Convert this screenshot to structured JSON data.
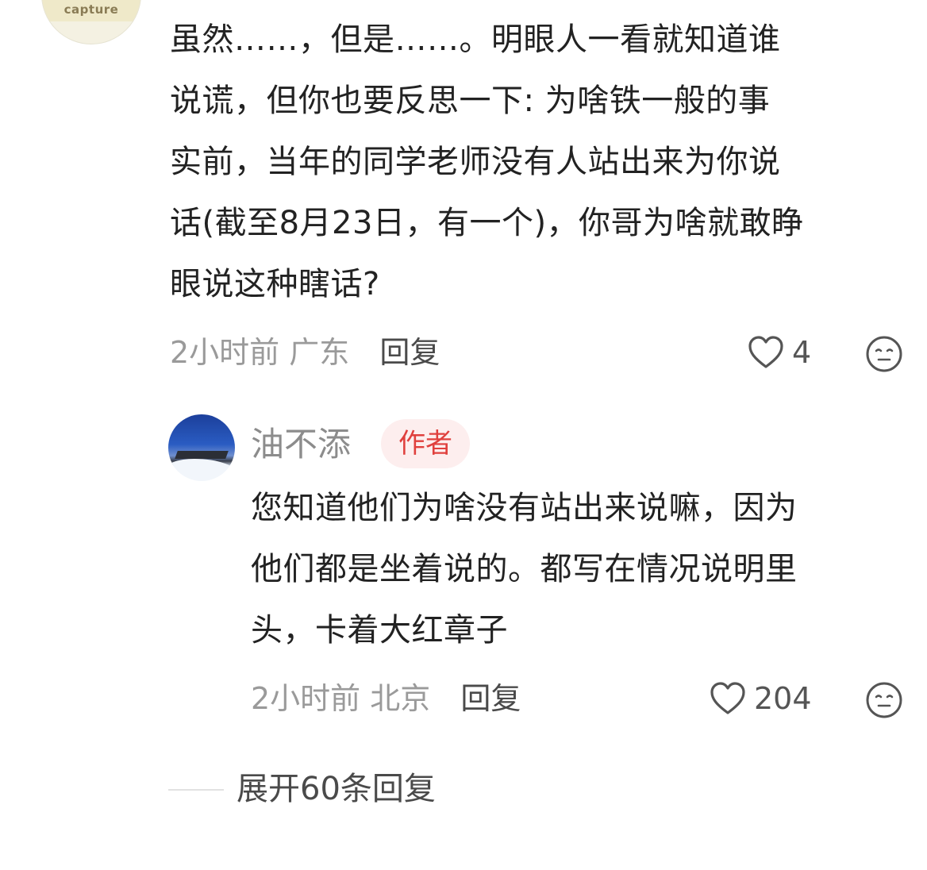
{
  "top_comment": {
    "avatar_label": "capture",
    "text_lines": [
      "虽然……，但是……。明眼人一看就知道谁",
      "说谎，但你也要反思一下: 为啥铁一般的事",
      "实前，当年的同学老师没有人站出来为你说",
      "话(截至8月23日，有一个)，你哥为啥就敢睁",
      "眼说这种瞎话?"
    ],
    "time": "2小时前",
    "location": "广东",
    "reply_label": "回复",
    "likes": "4",
    "like_icon": "heart-outline-icon",
    "emoji_icon": "neutral-face-icon"
  },
  "reply": {
    "username": "油不添",
    "badge": "作者",
    "text_lines": [
      "您知道他们为啥没有站出来说嘛，因为",
      "他们都是坐着说的。都写在情况说明里",
      "头，卡着大红章子"
    ],
    "time": "2小时前",
    "location": "北京",
    "reply_label": "回复",
    "likes": "204",
    "like_icon": "heart-outline-icon",
    "emoji_icon": "neutral-face-icon"
  },
  "expand_replies": {
    "label": "展开60条回复"
  },
  "colors": {
    "text": "#222222",
    "meta": "#9a9a9a",
    "badge_bg": "#fdeeee",
    "badge_text": "#e0403d"
  }
}
